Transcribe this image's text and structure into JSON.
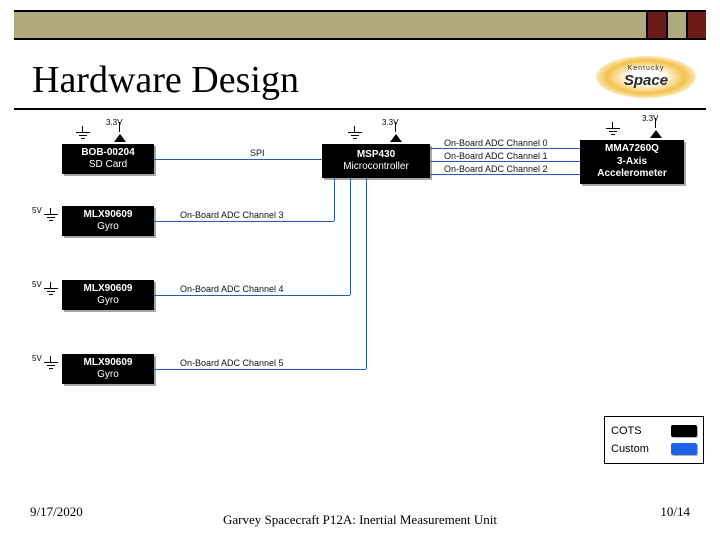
{
  "header": {
    "title": "Hardware Design",
    "logo_top": "Kentucky",
    "logo_main": "Space"
  },
  "diagram": {
    "voltage_3v3": "3.3V",
    "voltage_5v": "5V",
    "spi": "SPI",
    "adc0": "On-Board ADC Channel 0",
    "adc1": "On-Board ADC Channel 1",
    "adc2": "On-Board ADC Channel 2",
    "adc3": "On-Board ADC Channel 3",
    "adc4": "On-Board ADC Channel 4",
    "adc5": "On-Board ADC Channel 5",
    "blocks": {
      "sd_l1": "BOB-00204",
      "sd_l2": "SD Card",
      "gyro_l1": "MLX90609",
      "gyro_l2": "Gyro",
      "mcu_l1": "MSP430",
      "mcu_l2": "Microcontroller",
      "acc_l1": "MMA7260Q",
      "acc_l2": "3-Axis",
      "acc_l3": "Accelerometer"
    },
    "legend": {
      "cots": "COTS",
      "custom": "Custom"
    }
  },
  "footer": {
    "date": "9/17/2020",
    "title": "Garvey Spacecraft P12A: Inertial Measurement Unit",
    "page": "10/14"
  }
}
